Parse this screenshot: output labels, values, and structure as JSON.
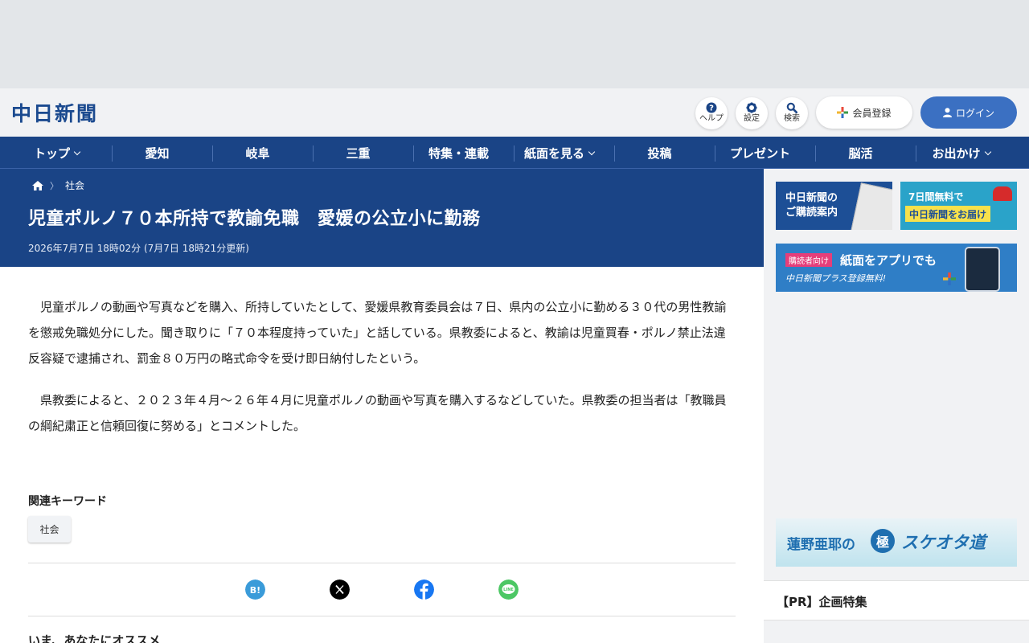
{
  "site": {
    "logo": "中日新聞"
  },
  "header_buttons": [
    {
      "label": "ヘルプ",
      "icon": "help-icon"
    },
    {
      "label": "設定",
      "icon": "gear-icon"
    },
    {
      "label": "検索",
      "icon": "search-icon"
    }
  ],
  "register_label": "会員登録",
  "login_label": "ログイン",
  "nav": [
    {
      "label": "トップ",
      "dropdown": true
    },
    {
      "label": "愛知",
      "dropdown": false
    },
    {
      "label": "岐阜",
      "dropdown": false
    },
    {
      "label": "三重",
      "dropdown": false
    },
    {
      "label": "特集・連載",
      "dropdown": false
    },
    {
      "label": "紙面を見る",
      "dropdown": true
    },
    {
      "label": "投稿",
      "dropdown": false
    },
    {
      "label": "プレゼント",
      "dropdown": false
    },
    {
      "label": "脳活",
      "dropdown": false
    },
    {
      "label": "お出かけ",
      "dropdown": true
    }
  ],
  "breadcrumb": {
    "category": "社会"
  },
  "article": {
    "title": "児童ポルノ７０本所持で教諭免職　愛媛の公立小に勤務",
    "date": "2026年7月7日 18時02分 (7月7日 18時21分更新)",
    "paragraphs": [
      "児童ポルノの動画や写真などを購入、所持していたとして、愛媛県教育委員会は７日、県内の公立小に勤める３０代の男性教諭を懲戒免職処分にした。聞き取りに「７０本程度持っていた」と話している。県教委によると、教諭は児童買春・ポルノ禁止法違反容疑で逮捕され、罰金８０万円の略式命令を受け即日納付したという。",
      "県教委によると、２０２３年４月～２６年４月に児童ポルノの動画や写真を購入するなどしていた。県教委の担当者は「教職員の綱紀粛正と信頼回復に努める」とコメントした。"
    ]
  },
  "keywords": {
    "label": "関連キーワード",
    "tags": [
      "社会"
    ]
  },
  "share": [
    "hatena-bookmark-icon",
    "x-icon",
    "facebook-icon",
    "line-icon"
  ],
  "share_text": {
    "hatena": "B!",
    "line": "LINE"
  },
  "recommend_title": "いま、あなたにオススメ",
  "sidebar": {
    "banner1": {
      "line1": "中日新聞の",
      "line2": "ご購読案内"
    },
    "banner2": {
      "line1": "7日間無料で",
      "line2": "中日新聞をお届け"
    },
    "banner3": {
      "badge": "購読者向け",
      "title": "紙面をアプリでも",
      "sub": "中日新聞プラス登録無料!"
    },
    "banner4": {
      "text_a": "蓮野亜耶の",
      "text_b": "極",
      "text_c": "スケオタ道"
    },
    "pr_title": "【PR】企画特集"
  },
  "colors": {
    "navy": "#1a4486",
    "accent_blue": "#3b70c2",
    "teal_banner": "#2aa3c9"
  }
}
